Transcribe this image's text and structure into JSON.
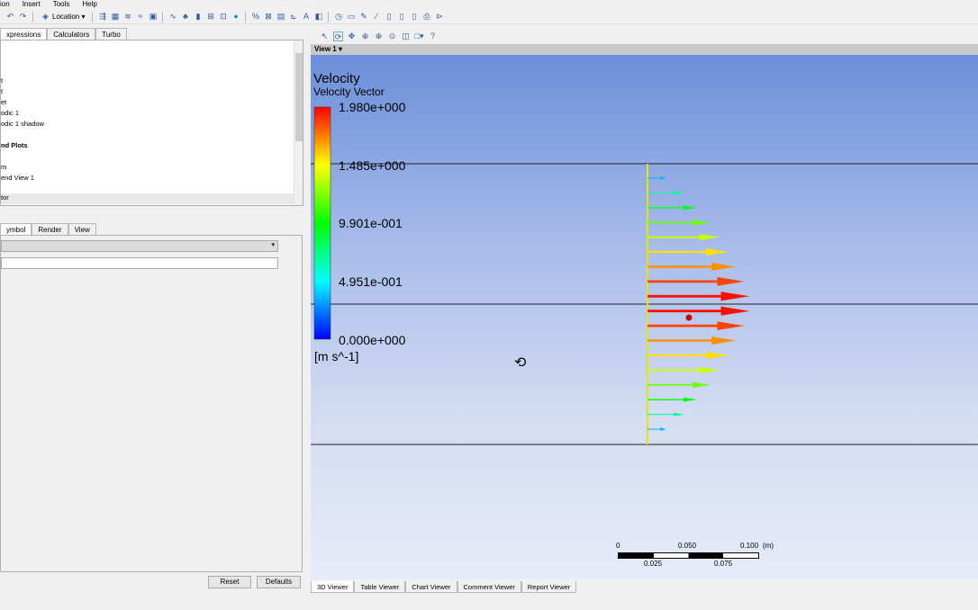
{
  "menu": [
    "ion",
    "Insert",
    "Tools",
    "Help"
  ],
  "toolbar": {
    "location_label": "Location ▾"
  },
  "left_tabs": [
    "xpressions",
    "Calculators",
    "Turbo"
  ],
  "tree_items": [
    {
      "label": "t",
      "bold": false
    },
    {
      "label": "t",
      "bold": false
    },
    {
      "label": "et",
      "bold": false
    },
    {
      "label": "odic 1",
      "bold": false
    },
    {
      "label": "odic 1 shadow",
      "bold": false
    },
    {
      "label": "nd Plots",
      "bold": true
    },
    {
      "label": "m",
      "bold": false
    },
    {
      "label": "end View 1",
      "bold": false
    },
    {
      "label": "tor",
      "bold": false
    }
  ],
  "detail_tabs": [
    "ymbol",
    "Render",
    "View"
  ],
  "buttons": {
    "reset": "Reset",
    "defaults": "Defaults"
  },
  "view": {
    "title": "View 1"
  },
  "legend": {
    "title": "Velocity",
    "subtitle": "Velocity Vector",
    "ticks": [
      "1.980e+000",
      "1.485e+000",
      "9.901e-001",
      "4.951e-001",
      "0.000e+000"
    ],
    "unit": "[m s^-1]",
    "max": 1.98
  },
  "vectors_velocity": [
    0.35,
    0.7,
    0.95,
    1.2,
    1.38,
    1.55,
    1.7,
    1.85,
    1.95,
    1.95,
    1.85,
    1.7,
    1.55,
    1.38,
    1.2,
    0.95,
    0.7,
    0.35
  ],
  "scale": {
    "top": [
      "0",
      "0.050",
      "0.100",
      "(m)"
    ],
    "bottom": [
      "0.025",
      "0.075"
    ]
  },
  "bottom_tabs": [
    "3D Viewer",
    "Table Viewer",
    "Chart Viewer",
    "Comment Viewer",
    "Report Viewer"
  ]
}
